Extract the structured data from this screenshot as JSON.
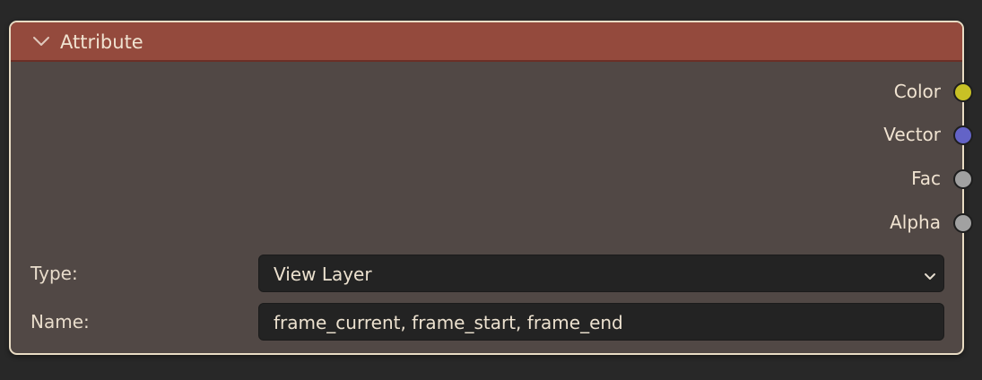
{
  "node": {
    "title": "Attribute",
    "header_color": "#944a3d",
    "outputs": [
      {
        "label": "Color",
        "color": "#c8c125"
      },
      {
        "label": "Vector",
        "color": "#6363c7"
      },
      {
        "label": "Fac",
        "color": "#a1a1a1"
      },
      {
        "label": "Alpha",
        "color": "#a1a1a1"
      }
    ],
    "properties": {
      "type": {
        "label": "Type:",
        "value": "View Layer"
      },
      "name": {
        "label": "Name:",
        "value": "frame_current, frame_start, frame_end"
      }
    }
  },
  "icons": {
    "collapse": "chevron-down-icon",
    "dropdown": "chevron-down-icon"
  }
}
